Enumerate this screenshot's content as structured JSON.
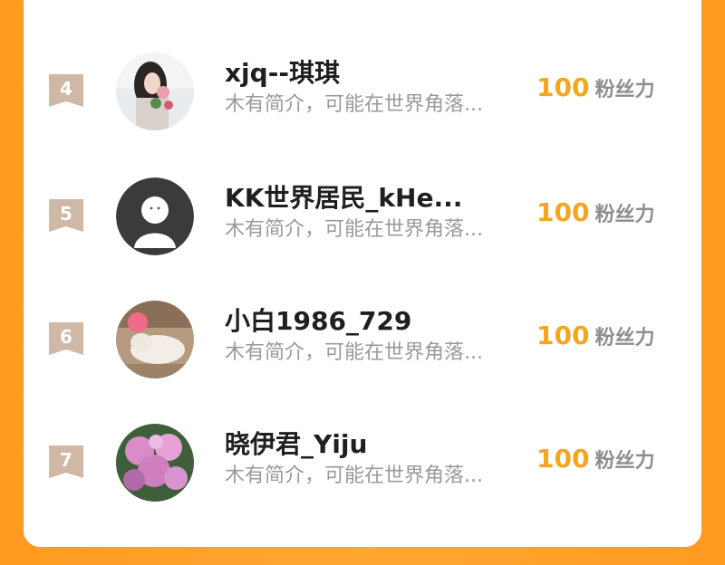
{
  "list": {
    "rows": [
      {
        "rank": "4",
        "name": "xjq--琪琪",
        "bio": "木有简介，可能在世界角落...",
        "fans_count": "100",
        "fans_label": "粉丝力"
      },
      {
        "rank": "5",
        "name": "KK世界居民_kHe...",
        "bio": "木有简介，可能在世界角落...",
        "fans_count": "100",
        "fans_label": "粉丝力"
      },
      {
        "rank": "6",
        "name": "小白1986_729",
        "bio": "木有简介，可能在世界角落...",
        "fans_count": "100",
        "fans_label": "粉丝力"
      },
      {
        "rank": "7",
        "name": "晓伊君_Yiju",
        "bio": "木有简介，可能在世界角落...",
        "fans_count": "100",
        "fans_label": "粉丝力"
      }
    ]
  },
  "colors": {
    "background": "#ffa733",
    "accent_count": "#f5a51e",
    "rank_badge": "#cfb8a6",
    "name_text": "#1f1f1f",
    "bio_text": "#9a9a9a"
  },
  "icons": {
    "rank_badge": "ribbon-badge-icon",
    "default_avatar": "default-user-avatar-icon"
  }
}
